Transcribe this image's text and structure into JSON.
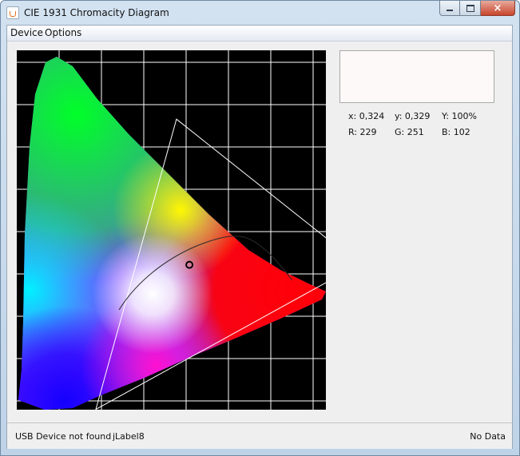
{
  "window": {
    "title": "CIE 1931 Chromacity Diagram",
    "close_glyph": "×"
  },
  "menu": {
    "items": [
      {
        "label": "Device"
      },
      {
        "label": "Options"
      }
    ]
  },
  "readout": {
    "x": "x: 0,324",
    "y": "y: 0,329",
    "Y": "Y: 100%",
    "R": "R: 229",
    "G": "G: 251",
    "B": "B: 102"
  },
  "preview": {
    "color": "#fdf9f9"
  },
  "diagram": {
    "marker_x": 0.324,
    "marker_y": 0.329,
    "gamut_triangle": {
      "red": [
        0.64,
        0.33
      ],
      "green": [
        0.3,
        0.6
      ],
      "blue": [
        0.15,
        0.06
      ]
    },
    "colors": {
      "background": "#000000",
      "grid": "#ffffff",
      "triangle": "#ffffff",
      "planckian_locus": "#2a2a2a",
      "marker": "#000000"
    }
  },
  "status": {
    "usb": "USB Device not found",
    "label": "jLabel8",
    "data": "No Data"
  }
}
